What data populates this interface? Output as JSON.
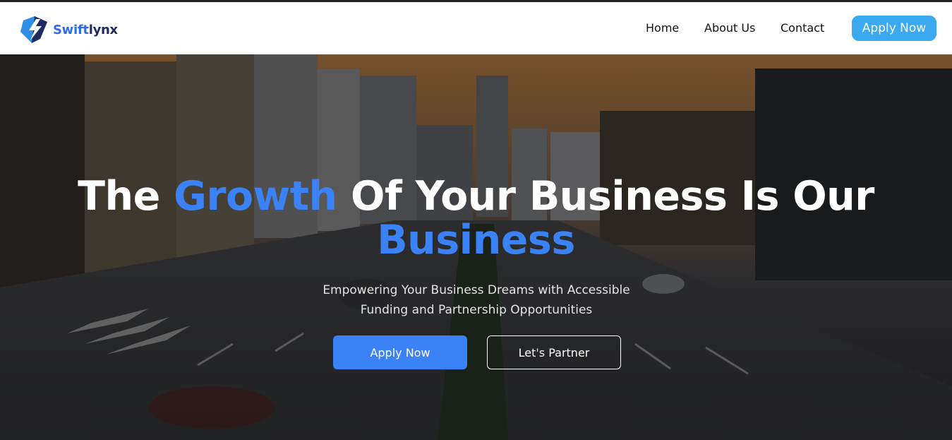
{
  "brand": {
    "name_part1": "Swift",
    "name_part2": "lynx"
  },
  "nav": {
    "links": [
      "Home",
      "About Us",
      "Contact"
    ],
    "cta": "Apply Now"
  },
  "hero": {
    "headline_part1": "The ",
    "headline_accent1": "Growth",
    "headline_part2": " Of Your Business Is Our ",
    "headline_accent2": "Business",
    "subtitle": "Empowering Your Business Dreams with Accessible Funding and Partnership Opportunities",
    "primary_button": "Apply Now",
    "secondary_button": "Let's Partner"
  },
  "colors": {
    "accent_blue": "#3b82f6",
    "nav_cta": "#3aa9f0",
    "brand_navy": "#1f2a5e"
  }
}
